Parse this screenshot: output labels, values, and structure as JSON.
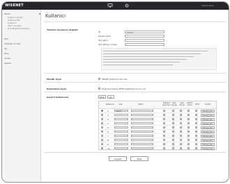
{
  "brand": {
    "name": "WISENET"
  },
  "header": {
    "user_text": "admin  Çıkış"
  },
  "sidebar": {
    "groups": [
      {
        "label": "Temel",
        "items": [
          "Kullanıcı grubu",
          "Video profili",
          "Kullanıcı",
          "Tarih ve Saat",
          "IP & Bağlantı Noktası"
        ]
      },
      {
        "label": "PTZ"
      },
      {
        "label": "Görüntü ve Ses"
      },
      {
        "label": "Ağ"
      },
      {
        "label": "Olay"
      },
      {
        "label": "Analiz"
      },
      {
        "label": "Sistem"
      }
    ]
  },
  "page": {
    "title": "Kullanıcı"
  },
  "admin_section": {
    "title": "Yönetici Ayarlarını değiştir",
    "fields": [
      {
        "label": "ID",
        "value": "admin"
      },
      {
        "label": "Geçerli şifre",
        "value": ""
      },
      {
        "label": "Yeni şifre",
        "value": ""
      },
      {
        "label": "Yeni şifreyi onayla",
        "value": ""
      }
    ]
  },
  "guest": {
    "title": "Misafir Ayarı",
    "checkbox_label": "Misafir erişimine izin ver"
  },
  "auth": {
    "title": "Doğrulama Ayarı",
    "checkbox_label": "Doğrulanmamış RTSP bağlantısına izin ver"
  },
  "users": {
    "title": "Geçerli kullanıcılar",
    "add": "Ekle",
    "delete": "Sil",
    "columns": [
      "Kullanıcı",
      "Adı",
      "Şifre",
      "Sistem ayarları",
      "Ses Çıkışı",
      "Ses Girişi",
      "Alarm çıkışı",
      "PTZ",
      "Profil"
    ],
    "rows": [
      {
        "index": "1",
        "name": "user1",
        "profile": "Varsayılan"
      },
      {
        "index": "2",
        "name": "",
        "profile": "Varsayılan"
      },
      {
        "index": "3",
        "name": "",
        "profile": "Varsayılan"
      },
      {
        "index": "4",
        "name": "",
        "profile": "Varsayılan"
      },
      {
        "index": "5",
        "name": "",
        "profile": "Varsayılan"
      },
      {
        "index": "6",
        "name": "",
        "profile": "Varsayılan"
      },
      {
        "index": "7",
        "name": "",
        "profile": "Varsayılan"
      },
      {
        "index": "8",
        "name": "",
        "profile": "Varsayılan"
      },
      {
        "index": "9",
        "name": "",
        "profile": "Varsayılan"
      },
      {
        "index": "10",
        "name": "",
        "profile": "Varsayılan"
      }
    ]
  },
  "actions": {
    "apply": "Uygula",
    "cancel": "İptal"
  },
  "colors": {
    "topbar": "#25262b",
    "sidebar": "#f3f3f3",
    "note": "#f4f4f4",
    "frame": "#8f8f8f"
  }
}
